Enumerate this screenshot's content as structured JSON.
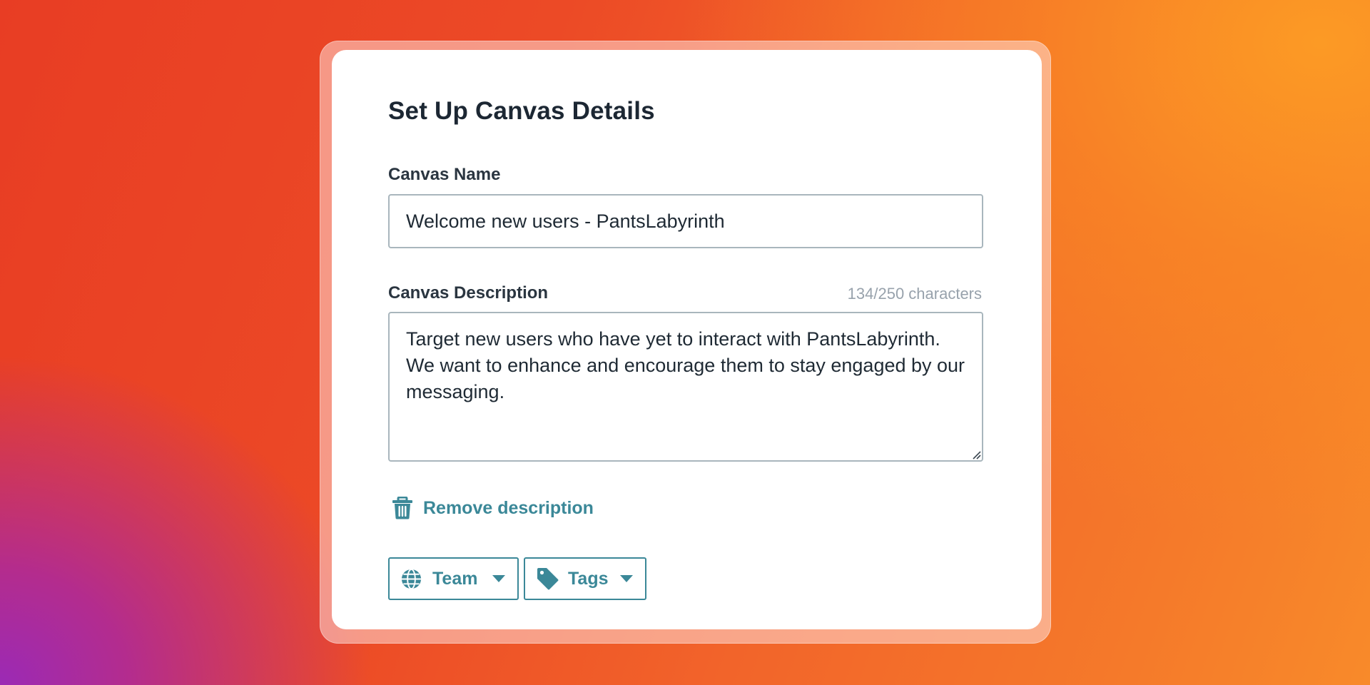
{
  "dialog": {
    "title": "Set Up Canvas Details",
    "name_label": "Canvas Name",
    "name_value": "Welcome new users - PantsLabyrinth",
    "description_label": "Canvas Description",
    "description_counter": "134/250 characters",
    "description_value": "Target new users who have yet to interact with PantsLabyrinth. We want to enhance and encourage them to stay engaged by our messaging.",
    "remove_description_label": "Remove description",
    "team_dropdown_label": "Team",
    "tags_dropdown_label": "Tags"
  },
  "icons": {
    "remove": "trash-icon",
    "team": "globe-icon",
    "tags": "tag-icon",
    "dropdown": "caret-down-icon"
  },
  "colors": {
    "accent": "#3b8898",
    "title_text": "#1c2733",
    "input_border": "#a9b6bd",
    "counter_text": "#98a2ac",
    "background_start": "#e83d24",
    "background_end": "#f88a2a"
  }
}
